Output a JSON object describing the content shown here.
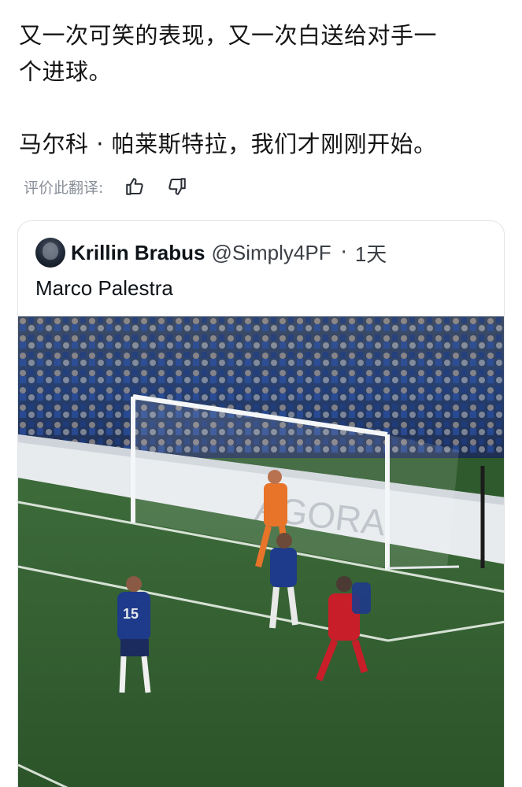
{
  "post": {
    "line1": "又一次可笑的表现，又一次白送给对手一",
    "line2": "个进球。",
    "line3": "马尔科 · 帕莱斯特拉，我们才刚刚开始。"
  },
  "translation": {
    "label": "评价此翻译:",
    "like_icon": "thumbs-up-icon",
    "dislike_icon": "thumbs-down-icon"
  },
  "quoted": {
    "display_name": "Krillin Brabus",
    "handle": "@Simply4PF",
    "separator": "·",
    "time": "1天",
    "text": "Marco Palestra",
    "media": {
      "board_text": "AGORA",
      "player_number": "15",
      "keeper_color": "#e8742a",
      "home_color": "#1e3a8a",
      "away_color": "#c81e2a"
    }
  }
}
